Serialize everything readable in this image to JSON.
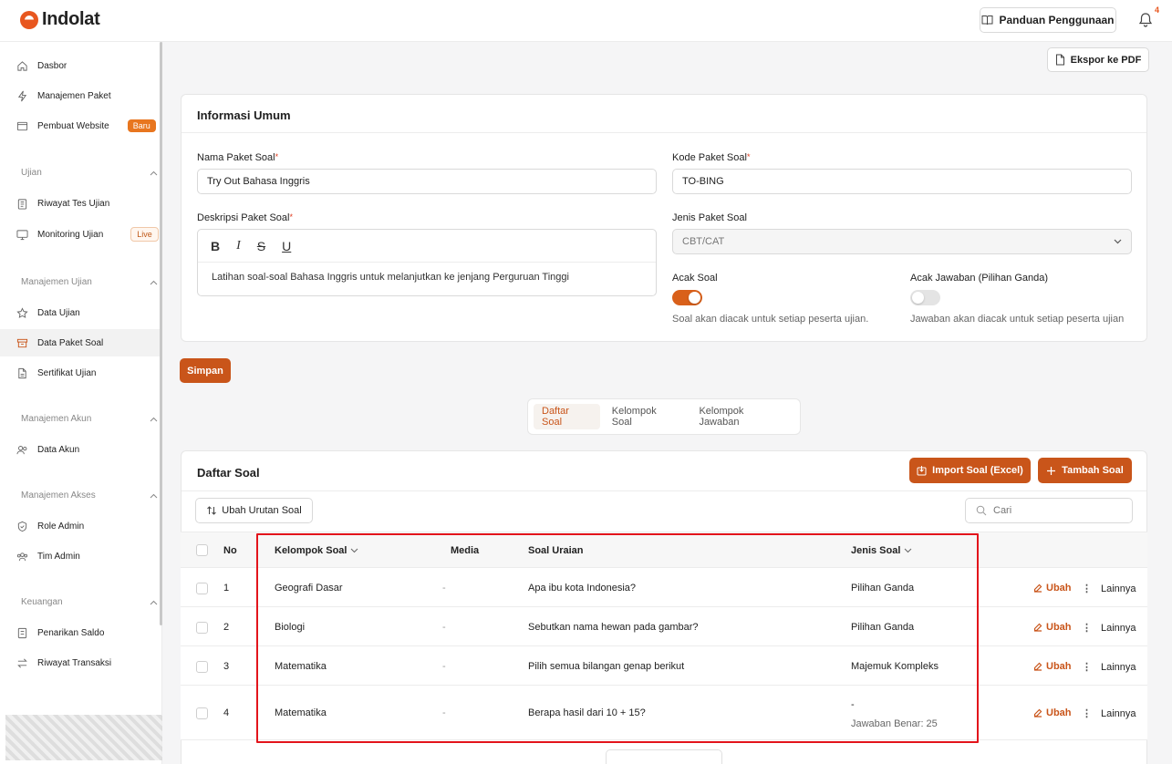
{
  "brand": {
    "name": "Indolat",
    "accent": "#c9551a"
  },
  "header": {
    "guide_label": "Panduan Penggunaan",
    "notif_count": "4"
  },
  "sidebar": {
    "items_top": [
      {
        "label": "Dasbor",
        "icon": "home-icon"
      },
      {
        "label": "Manajemen Paket",
        "icon": "bolt-icon"
      },
      {
        "label": "Pembuat Website",
        "icon": "browser-icon",
        "badge": "Baru"
      }
    ],
    "sections": [
      {
        "title": "Ujian",
        "items": [
          {
            "label": "Riwayat Tes Ujian",
            "icon": "clipboard-icon"
          },
          {
            "label": "Monitoring Ujian",
            "icon": "monitor-icon",
            "badge": "Live"
          }
        ]
      },
      {
        "title": "Manajemen Ujian",
        "items": [
          {
            "label": "Data Ujian",
            "icon": "star-icon"
          },
          {
            "label": "Data Paket Soal",
            "icon": "archive-icon"
          },
          {
            "label": "Sertifikat Ujian",
            "icon": "file-icon"
          }
        ]
      },
      {
        "title": "Manajemen Akun",
        "items": [
          {
            "label": "Data Akun",
            "icon": "users-icon"
          }
        ]
      },
      {
        "title": "Manajemen Akses",
        "items": [
          {
            "label": "Role Admin",
            "icon": "shield-icon"
          },
          {
            "label": "Tim Admin",
            "icon": "team-icon"
          }
        ]
      },
      {
        "title": "Keuangan",
        "items": [
          {
            "label": "Penarikan Saldo",
            "icon": "wallet-icon"
          },
          {
            "label": "Riwayat Transaksi",
            "icon": "transfer-icon"
          }
        ]
      }
    ]
  },
  "toolbar": {
    "export_label": "Ekspor ke PDF"
  },
  "info": {
    "title": "Informasi Umum",
    "name_label": "Nama Paket Soal",
    "name_value": "Try Out Bahasa Inggris",
    "code_label": "Kode Paket Soal",
    "code_value": "TO-BING",
    "desc_label": "Deskripsi Paket Soal",
    "desc_value": "Latihan soal-soal Bahasa Inggris untuk melanjutkan ke jenjang Perguruan Tinggi",
    "type_label": "Jenis Paket Soal",
    "type_value": "CBT/CAT",
    "shuffle_q_label": "Acak Soal",
    "shuffle_q_hint": "Soal akan diacak untuk setiap peserta ujian.",
    "shuffle_q_on": true,
    "shuffle_a_label": "Acak Jawaban (Pilihan Ganda)",
    "shuffle_a_hint": "Jawaban akan diacak untuk setiap peserta ujian",
    "shuffle_a_on": false,
    "save_label": "Simpan"
  },
  "tabs": [
    "Daftar Soal",
    "Kelompok Soal",
    "Kelompok Jawaban"
  ],
  "questions": {
    "title": "Daftar Soal",
    "import_label": "Import Soal (Excel)",
    "add_label": "Tambah Soal",
    "reorder_label": "Ubah Urutan Soal",
    "search_placeholder": "Cari",
    "columns": {
      "no": "No",
      "group": "Kelompok Soal",
      "media": "Media",
      "question": "Soal Uraian",
      "type": "Jenis Soal"
    },
    "edit_label": "Ubah",
    "more_label": "Lainnya",
    "rows": [
      {
        "no": "1",
        "group": "Geografi Dasar",
        "media": "-",
        "question": "Apa ibu kota Indonesia?",
        "type": "Pilihan Ganda",
        "note": ""
      },
      {
        "no": "2",
        "group": "Biologi",
        "media": "-",
        "question": "Sebutkan nama hewan pada gambar?",
        "type": "Pilihan Ganda",
        "note": ""
      },
      {
        "no": "3",
        "group": "Matematika",
        "media": "-",
        "question": "Pilih semua bilangan genap berikut",
        "type": "Majemuk Kompleks",
        "note": ""
      },
      {
        "no": "4",
        "group": "Matematika",
        "media": "-",
        "question": "Berapa hasil dari 10 + 15?",
        "type": "-",
        "note": "Jawaban Benar: 25"
      }
    ]
  }
}
